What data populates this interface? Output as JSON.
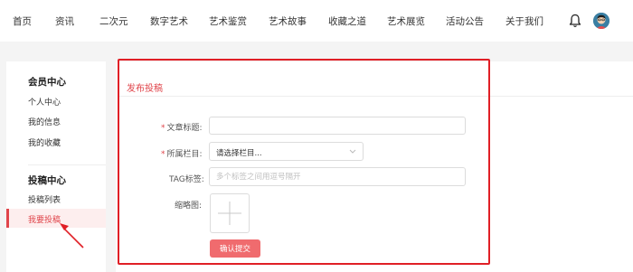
{
  "nav": {
    "items": [
      "首页",
      "资讯",
      "二次元",
      "数字艺术",
      "艺术鉴赏",
      "艺术故事",
      "收藏之道",
      "艺术展览",
      "活动公告",
      "关于我们"
    ],
    "bell_icon": "bell-icon",
    "avatar_icon": "user-avatar"
  },
  "sidebar": {
    "member_heading": "会员中心",
    "member_items": [
      "个人中心",
      "我的信息",
      "我的收藏"
    ],
    "submission_heading": "投稿中心",
    "submission_items": [
      "投稿列表",
      "我要投稿"
    ],
    "active_item": "我要投稿"
  },
  "form": {
    "title": "发布投稿",
    "article_title_label": "文章标题:",
    "article_title_value": "",
    "category_label": "所属栏目:",
    "category_value": "请选择栏目...",
    "tag_label": "TAG标签:",
    "tag_placeholder": "多个标签之间用逗号隔开",
    "thumbnail_label": "缩略图:",
    "submit_label": "确认提交",
    "required_mark": "*"
  },
  "colors": {
    "accent": "#e0454b",
    "highlight_border": "#e01f26",
    "submit_bg": "#f06b6e"
  }
}
